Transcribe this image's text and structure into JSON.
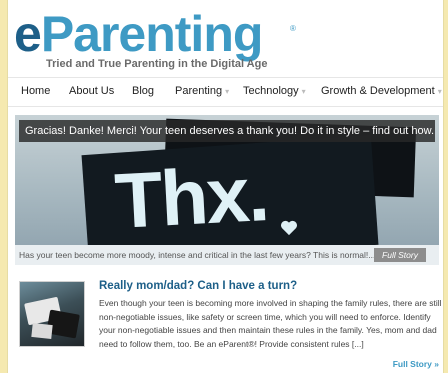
{
  "header": {
    "logo_e": "e",
    "logo_rest": "Parenting",
    "logo_reg": "®",
    "tagline": "Tried and True Parenting in the Digital Age"
  },
  "nav": {
    "items": [
      {
        "label": "Home"
      },
      {
        "label": "About Us"
      },
      {
        "label": "Blog"
      },
      {
        "label": "Parenting",
        "has_dropdown": true
      },
      {
        "label": "Technology",
        "has_dropdown": true
      },
      {
        "label": "Growth & Development",
        "has_dropdown": true
      }
    ],
    "caret": "▾"
  },
  "feature": {
    "headline": "Gracias! Danke! Merci! Your teen deserves a thank you! Do it in style – find out how.",
    "image_text": "Thx.",
    "caption": "Has your teen become more moody, intense and critical in the last few years? This is normal!...",
    "full_story_label": "Full Story"
  },
  "article": {
    "title": "Really mom/dad? Can I have a turn?",
    "excerpt": "Even though your teen is becoming more involved in shaping the family rules, there are still non-negotiable issues, like safety or screen time, which you will need to enforce. Identify your non-negotiable issues and then maintain these rules in the family. Yes, mom and dad need to follow them, too. Be an eParent®! Provide consistent rules [...]",
    "more_label": "Full Story »"
  },
  "colors": {
    "brand_dark": "#1d5f88",
    "brand_light": "#3e9ac4",
    "page_bg": "#f5e9b0"
  }
}
